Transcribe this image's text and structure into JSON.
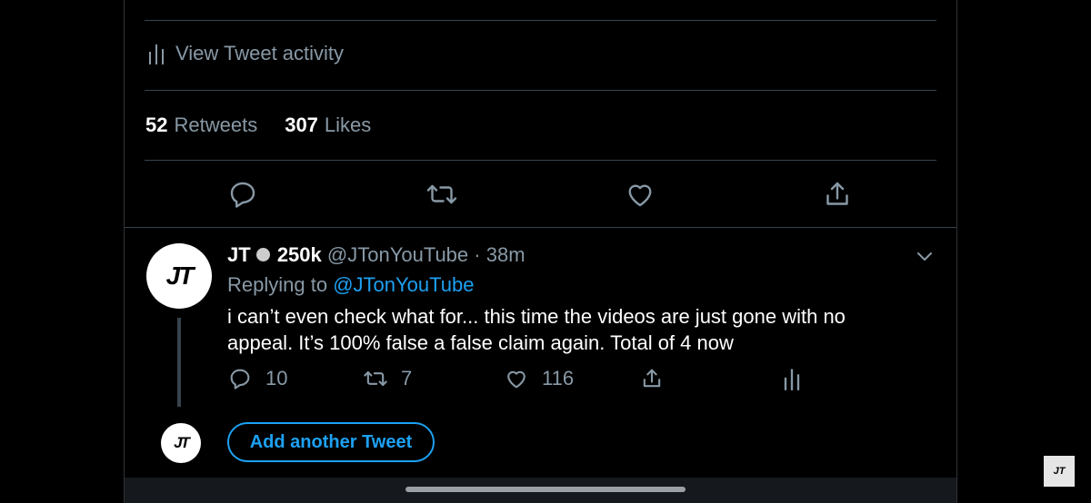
{
  "main_tweet": {
    "activity_label": "View Tweet activity",
    "stats": [
      {
        "count": "52",
        "label": "Retweets"
      },
      {
        "count": "307",
        "label": "Likes"
      }
    ],
    "actions": [
      "reply-icon",
      "retweet-icon",
      "like-icon",
      "share-icon"
    ]
  },
  "reply": {
    "avatar_text": "JT",
    "name": "JT",
    "badge": "250k",
    "handle": "@JTonYouTube",
    "separator": "·",
    "time": "38m",
    "replying_prefix": "Replying to",
    "replying_to": "@JTonYouTube",
    "text": "i can’t even check what for... this time the videos are just gone with no appeal. It’s 100% false a false claim again. Total of 4 now",
    "counts": {
      "replies": "10",
      "retweets": "7",
      "likes": "116"
    }
  },
  "composer": {
    "avatar_text": "JT",
    "add_button_label": "Add another Tweet"
  },
  "watermark": "JT",
  "colors": {
    "accent": "#1da1f2",
    "muted": "#8899a6",
    "divider": "#38444d",
    "background": "#000000"
  }
}
